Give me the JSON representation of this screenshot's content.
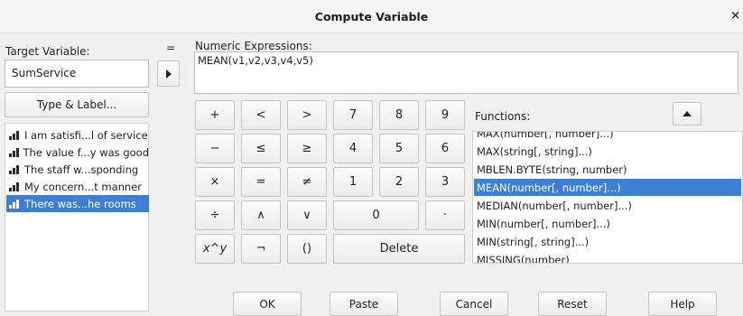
{
  "window": {
    "title": "Compute Variable",
    "close_glyph": "×"
  },
  "target": {
    "label": "Target Variable:",
    "value": "SumService",
    "equals": "="
  },
  "type_label_button": "Type & Label...",
  "variables": [
    {
      "label": "I am satisfi...l of service",
      "selected": false
    },
    {
      "label": "The value f...y was good",
      "selected": false
    },
    {
      "label": "The staff w...sponding",
      "selected": false
    },
    {
      "label": "My concern...t manner",
      "selected": false
    },
    {
      "label": "There was...he rooms",
      "selected": true
    }
  ],
  "expression": {
    "label": "Numeric Expressions:",
    "value": "MEAN(v1,v2,v3,v4,v5)"
  },
  "keypad": {
    "row1": [
      "+",
      "<",
      ">",
      "7",
      "8",
      "9"
    ],
    "row2": [
      "−",
      "≤",
      "≥",
      "4",
      "5",
      "6"
    ],
    "row3": [
      "×",
      "=",
      "≠",
      "1",
      "2",
      "3"
    ],
    "row4": [
      "÷",
      "∧",
      "∨",
      "0",
      "·"
    ],
    "row5": [
      "x^y",
      "¬",
      "()",
      "Delete"
    ]
  },
  "functions": {
    "label": "Functions:",
    "items": [
      {
        "label": "MAX(number[, number]...)",
        "selected": false
      },
      {
        "label": "MAX(string[, string]...)",
        "selected": false
      },
      {
        "label": "MBLEN.BYTE(string, number)",
        "selected": false
      },
      {
        "label": "MEAN(number[, number]...)",
        "selected": true
      },
      {
        "label": "MEDIAN(number[, number]...)",
        "selected": false
      },
      {
        "label": "MIN(number[, number]...)",
        "selected": false
      },
      {
        "label": "MIN(string[, string]...)",
        "selected": false
      },
      {
        "label": "MISSING(number)",
        "selected": false
      }
    ]
  },
  "footer": {
    "ok": "OK",
    "paste": "Paste",
    "cancel": "Cancel",
    "reset": "Reset",
    "help": "Help"
  }
}
